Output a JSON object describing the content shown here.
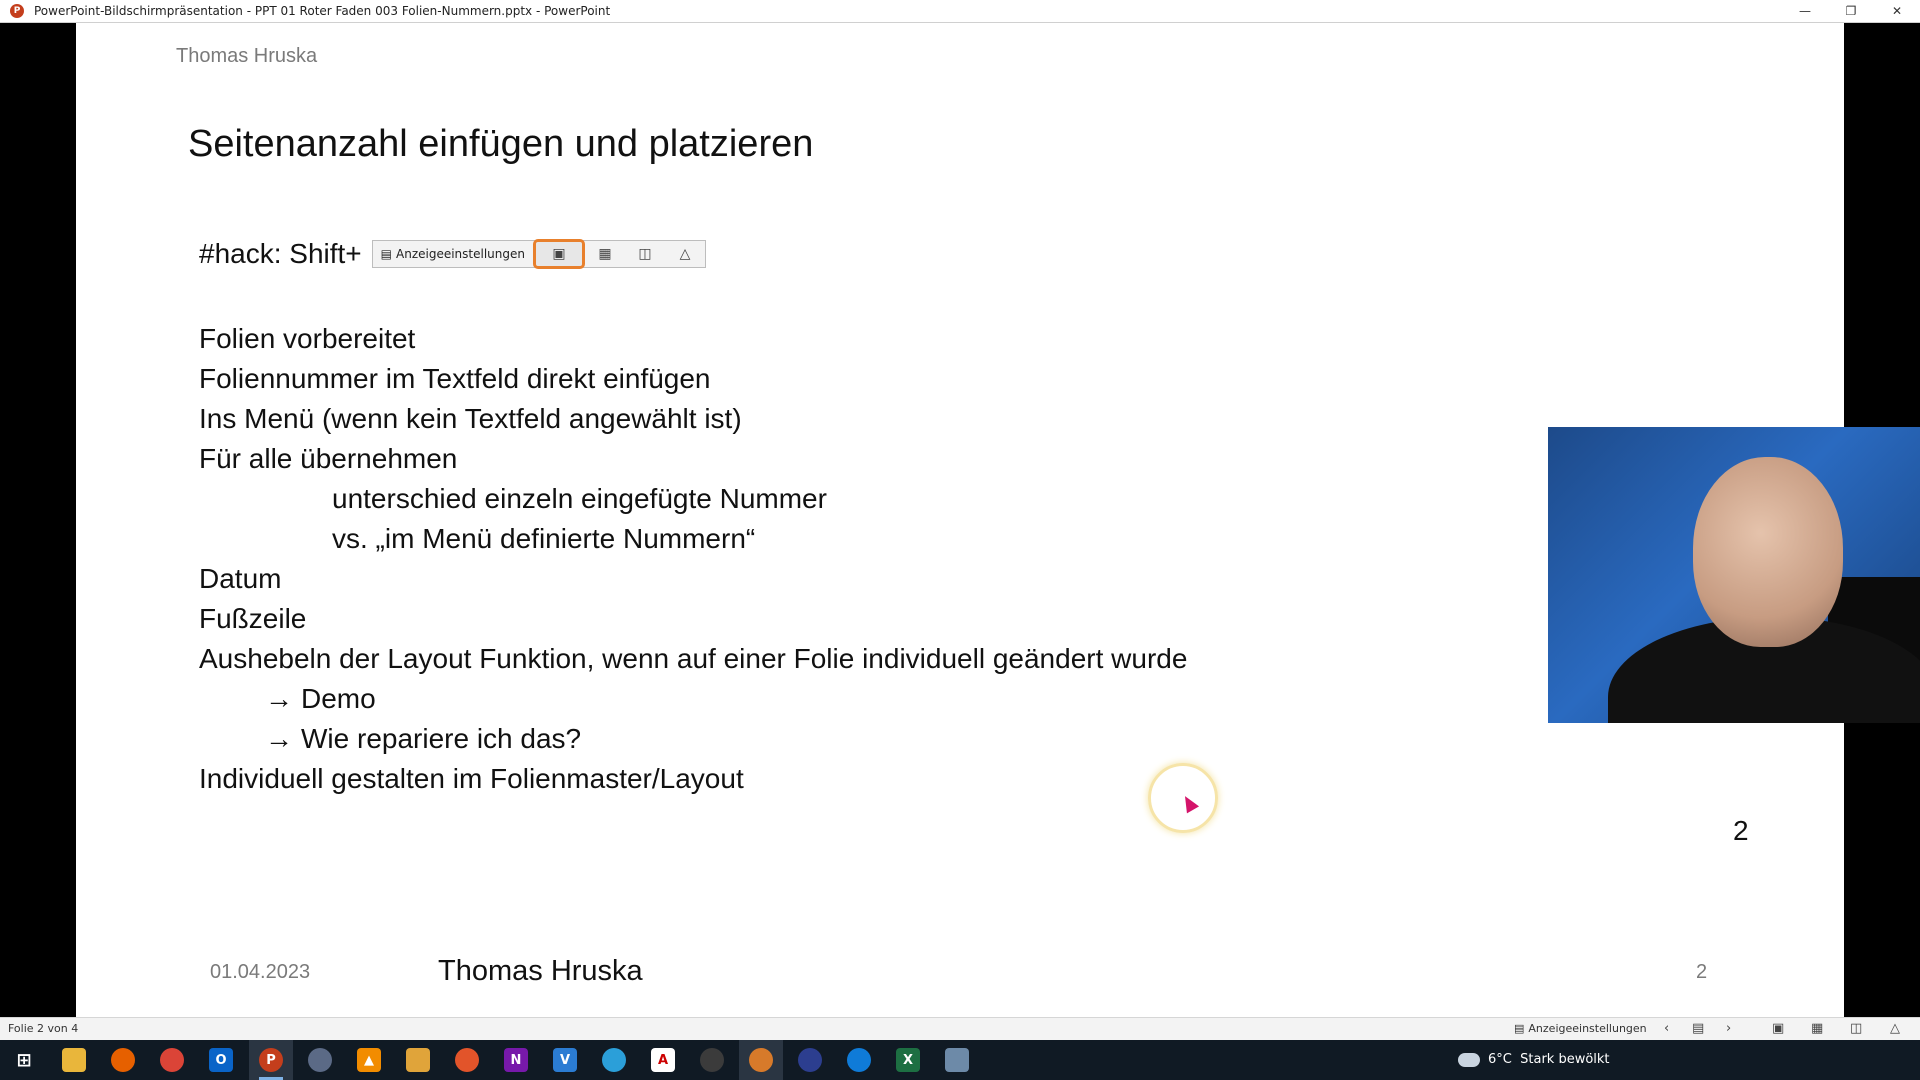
{
  "window": {
    "title": "PowerPoint-Bildschirmpräsentation  -  PPT 01 Roter Faden 003 Folien-Nummern.pptx - PowerPoint",
    "app_icon_letter": "P",
    "minimize_icon": "minimize-icon",
    "maximize_icon": "restore-icon",
    "close_icon": "close-icon"
  },
  "slide": {
    "header_author": "Thomas Hruska",
    "title": "Seitenanzahl einfügen und platzieren",
    "hack_text": "#hack: Shift+",
    "mini_toolbar": {
      "display_settings": "Anzeigeeinstellungen"
    },
    "bullets": [
      {
        "text": "Folien vorbereitet",
        "indent": 0
      },
      {
        "text": "Foliennummer im Textfeld direkt einfügen",
        "indent": 0
      },
      {
        "text": "Ins Menü (wenn kein Textfeld angewählt ist)",
        "indent": 0
      },
      {
        "text": "Für alle übernehmen",
        "indent": 0
      },
      {
        "text": "unterschied  einzeln eingefügte Nummer",
        "indent": 2
      },
      {
        "text": "vs. „im Menü definierte Nummern“",
        "indent": 2
      },
      {
        "text": "Datum",
        "indent": 0
      },
      {
        "text": "Fußzeile",
        "indent": 0
      },
      {
        "text": "Aushebeln der Layout Funktion, wenn auf einer Folie individuell geändert wurde",
        "indent": 0
      },
      {
        "text": "Demo",
        "indent": 1,
        "arrow": "→"
      },
      {
        "text": "Wie repariere ich das?",
        "indent": 1,
        "arrow": "→"
      },
      {
        "text": "Individuell gestalten im Folienmaster/Layout",
        "indent": 0
      }
    ],
    "slide_number_big": "2",
    "footer_date": "01.04.2023",
    "footer_author": "Thomas Hruska",
    "footer_number": "2"
  },
  "statusbar": {
    "slide_info": "Folie 2 von 4",
    "display_settings": "Anzeigeeinstellungen"
  },
  "taskbar": {
    "weather_temp": "6°C",
    "weather_text": "Stark bewölkt",
    "colors": {
      "powerpoint": "#c43e1c",
      "onenote": "#7719aa",
      "excel": "#1d6f42",
      "edge": "#0f7bd8",
      "outlook": "#0a64c8",
      "firefox": "#e66000",
      "chrome": "#db4437"
    }
  }
}
